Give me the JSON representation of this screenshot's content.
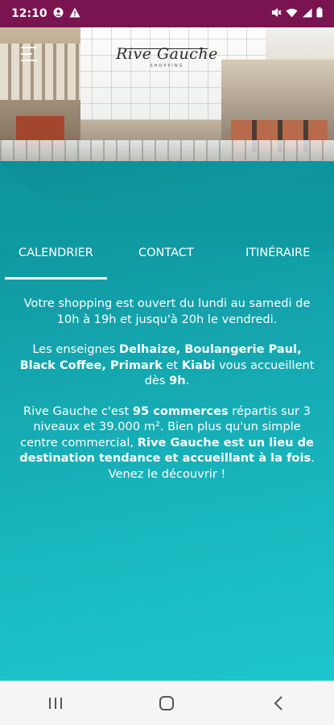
{
  "status_bar": {
    "time": "12:10",
    "left_icons": [
      "account-circle-icon",
      "warning-icon"
    ],
    "right_icons": [
      "mute-icon",
      "wifi-icon",
      "signal-icon",
      "battery-icon"
    ]
  },
  "header": {
    "logo_text": "Rive Gauche",
    "logo_subtitle": "SHOPPING",
    "menu_icon": "hamburger-menu-icon"
  },
  "tabs": [
    {
      "label": "CALENDRIER",
      "active": true
    },
    {
      "label": "CONTACT",
      "active": false
    },
    {
      "label": "ITINÉRAIRE",
      "active": false
    }
  ],
  "content": {
    "p1": "Votre shopping est ouvert du lundi au samedi de 10h à 19h et jusqu'à 20h le vendredi.",
    "p2": {
      "t1": "Les enseignes ",
      "b1": "Delhaize, Boulangerie Paul, Black Coffee, Primark",
      "t2": " et ",
      "b2": "Kiabi",
      "t3": " vous accueillent dès ",
      "b3": "9h",
      "t4": "."
    },
    "p3": {
      "t1": "Rive Gauche c'est ",
      "b1": "95 commerces",
      "t2": " répartis sur 3 niveaux et 39.000 m². Bien plus qu'un simple centre commercial, ",
      "b2": "Rive Gauche est un lieu de destination tendance et accueillant à la fois",
      "t3": ". Venez le découvrir !"
    }
  },
  "colors": {
    "status_bar": "#7a1450",
    "teal_top": "#0d8f97",
    "teal_bottom": "#1cc7cc"
  },
  "nav_bar": {
    "buttons": [
      "recent-apps-icon",
      "home-icon",
      "back-icon"
    ]
  }
}
